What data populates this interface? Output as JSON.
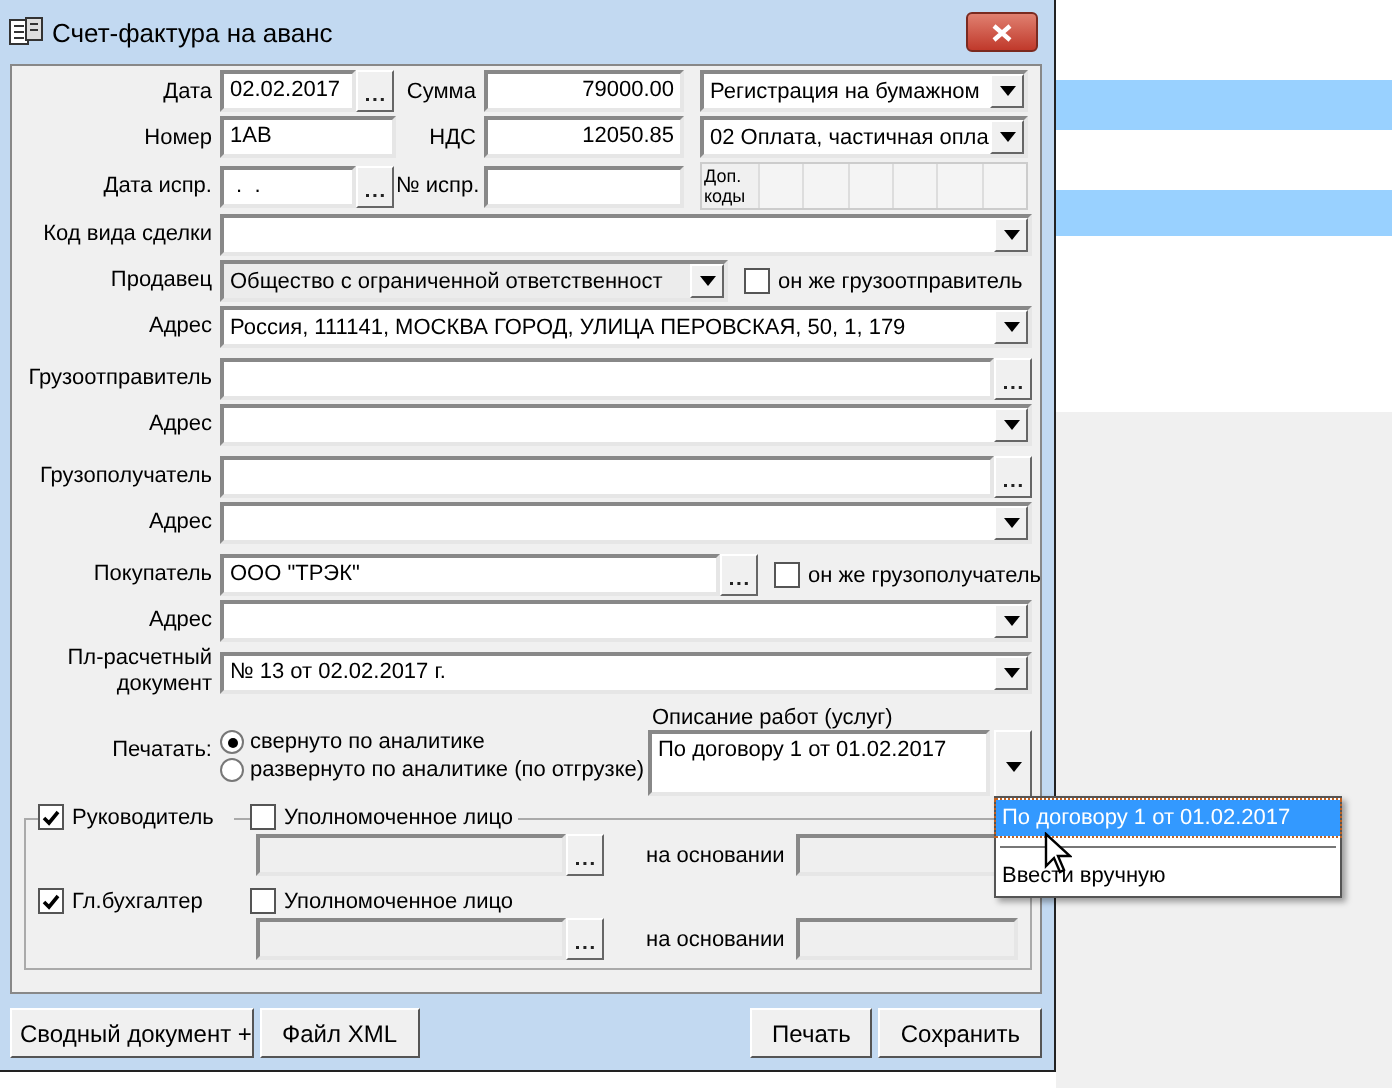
{
  "window": {
    "title": "Счет-фактура на аванс"
  },
  "header": {
    "date": {
      "label": "Дата",
      "value": "02.02.2017"
    },
    "sum": {
      "label": "Сумма",
      "value": "79000.00"
    },
    "registration": {
      "value": "Регистрация на бумажном"
    },
    "number": {
      "label": "Номер",
      "value": "1АВ"
    },
    "vat": {
      "label": "НДС",
      "value": "12050.85"
    },
    "operation_code": {
      "value": "02 Оплата, частичная опла"
    },
    "correction_date": {
      "label": "Дата испр.",
      "value": " .  ."
    },
    "correction_number": {
      "label": "№ испр."
    },
    "extra_codes": {
      "label": "Доп. коды"
    }
  },
  "fields": [
    {
      "kind": "combo",
      "label": "Код вида сделки"
    },
    {
      "kind": "combo_short",
      "label": "Продавец",
      "value": "Общество с ограниченной ответственност",
      "checkbox": {
        "label": "он же грузоотправитель",
        "checked": false
      }
    },
    {
      "kind": "combo",
      "label": "Адрес",
      "value": "Россия, 111141, МОСКВА ГОРОД,  УЛИЦА ПЕРОВСКАЯ,  50,  1,  179"
    },
    {
      "kind": "lookup",
      "label": "Грузоотправитель"
    },
    {
      "kind": "combo",
      "label": "Адрес"
    },
    {
      "kind": "lookup",
      "label": "Грузополучатель"
    },
    {
      "kind": "combo",
      "label": "Адрес"
    },
    {
      "kind": "lookup_short",
      "label": "Покупатель",
      "value": "ООО \"ТРЭК\"",
      "checkbox": {
        "label": "он же грузополучатель",
        "checked": false
      }
    },
    {
      "kind": "combo",
      "label": "Адрес"
    },
    {
      "kind": "combo",
      "label": "Пл-расчетный документ",
      "value": "№ 13 от 02.02.2017 г."
    }
  ],
  "print": {
    "label": "Печатать:",
    "options": [
      {
        "label": "свернуто по аналитике",
        "selected": true
      },
      {
        "label": "развернуто по аналитике (по отгрузке)",
        "selected": false
      }
    ],
    "description": {
      "label": "Описание работ (услуг)",
      "value": "По договору 1 от 01.02.2017"
    }
  },
  "signers": [
    {
      "label": "Руководитель",
      "checked": true,
      "proxy": {
        "label": "Уполномоченное лицо",
        "checked": false
      },
      "basis_label": "на основании"
    },
    {
      "label": "Гл.бухгалтер",
      "checked": true,
      "proxy": {
        "label": "Уполномоченное лицо",
        "checked": false
      },
      "basis_label": "на основании"
    }
  ],
  "buttons_left": [
    "Сводный документ +",
    "Файл XML"
  ],
  "buttons_right": [
    "Печать",
    "Сохранить"
  ],
  "dropdown": [
    {
      "kind": "option",
      "label": "По договору 1 от 01.02.2017",
      "selected": true
    },
    {
      "kind": "separator"
    },
    {
      "kind": "option",
      "label": "Ввести вручную",
      "selected": false
    }
  ]
}
